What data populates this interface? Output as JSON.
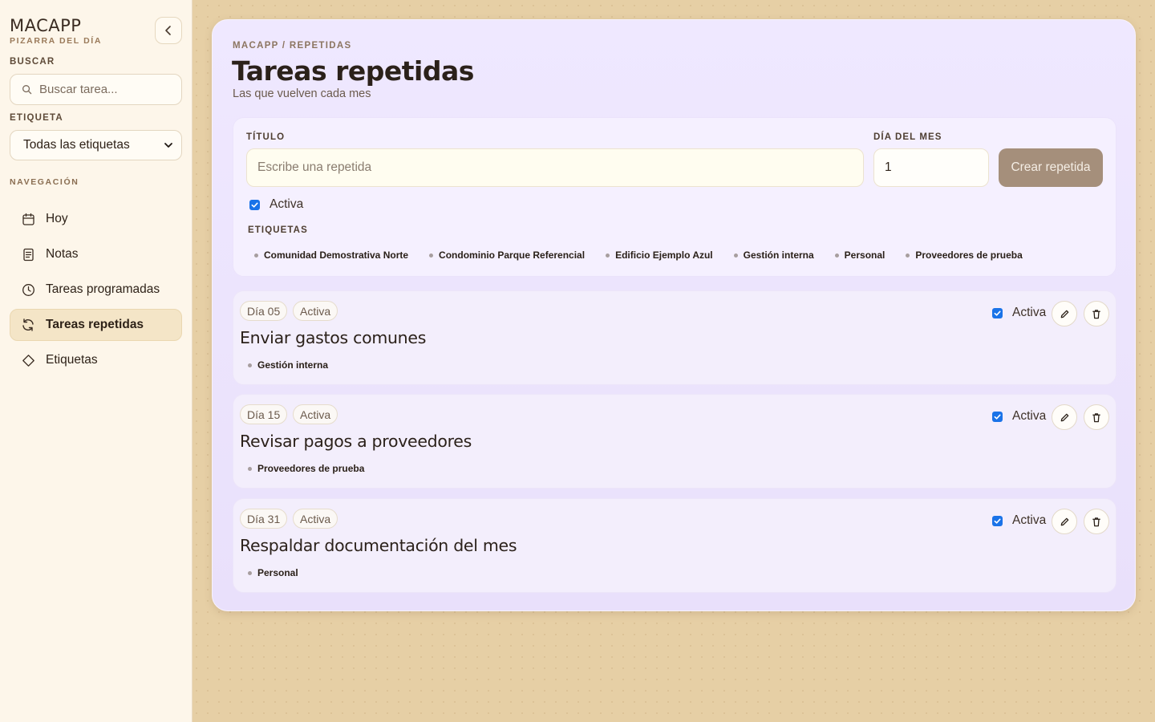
{
  "sidebar": {
    "brand": "MACAPP",
    "brand_sub": "PIZARRA DEL DÍA",
    "search_label": "BUSCAR",
    "search_placeholder": "Buscar tarea...",
    "tag_label": "ETIQUETA",
    "tag_select_value": "Todas las etiquetas",
    "nav_label": "NAVEGACIÓN",
    "nav": [
      {
        "label": "Hoy",
        "icon": "calendar-icon",
        "active": false
      },
      {
        "label": "Notas",
        "icon": "document-icon",
        "active": false
      },
      {
        "label": "Tareas programadas",
        "icon": "clock-icon",
        "active": false
      },
      {
        "label": "Tareas repetidas",
        "icon": "refresh-icon",
        "active": true
      },
      {
        "label": "Etiquetas",
        "icon": "tag-icon",
        "active": false
      }
    ]
  },
  "main": {
    "breadcrumb": "MACAPP / REPETIDAS",
    "title": "Tareas repetidas",
    "subtitle": "Las que vuelven cada mes",
    "form": {
      "title_label": "TÍTULO",
      "title_placeholder": "Escribe una repetida",
      "day_label": "DÍA DEL MES",
      "day_value": "1",
      "create_label": "Crear repetida",
      "active_label": "Activa",
      "tags_label": "ETIQUETAS",
      "tags": [
        "Comunidad Demostrativa Norte",
        "Condominio Parque Referencial",
        "Edificio Ejemplo Azul",
        "Gestión interna",
        "Personal",
        "Proveedores de prueba"
      ]
    },
    "items": [
      {
        "day": "Día 05",
        "status": "Activa",
        "title": "Enviar gastos comunes",
        "tag": "Gestión interna",
        "active_label": "Activa"
      },
      {
        "day": "Día 15",
        "status": "Activa",
        "title": "Revisar pagos a proveedores",
        "tag": "Proveedores de prueba",
        "active_label": "Activa"
      },
      {
        "day": "Día 31",
        "status": "Activa",
        "title": "Respaldar documentación del mes",
        "tag": "Personal",
        "active_label": "Activa"
      }
    ]
  },
  "colors": {
    "accent_checkbox": "#1a73e8",
    "create_button": "#a58f7b",
    "active_nav": "#f4e5c7"
  }
}
